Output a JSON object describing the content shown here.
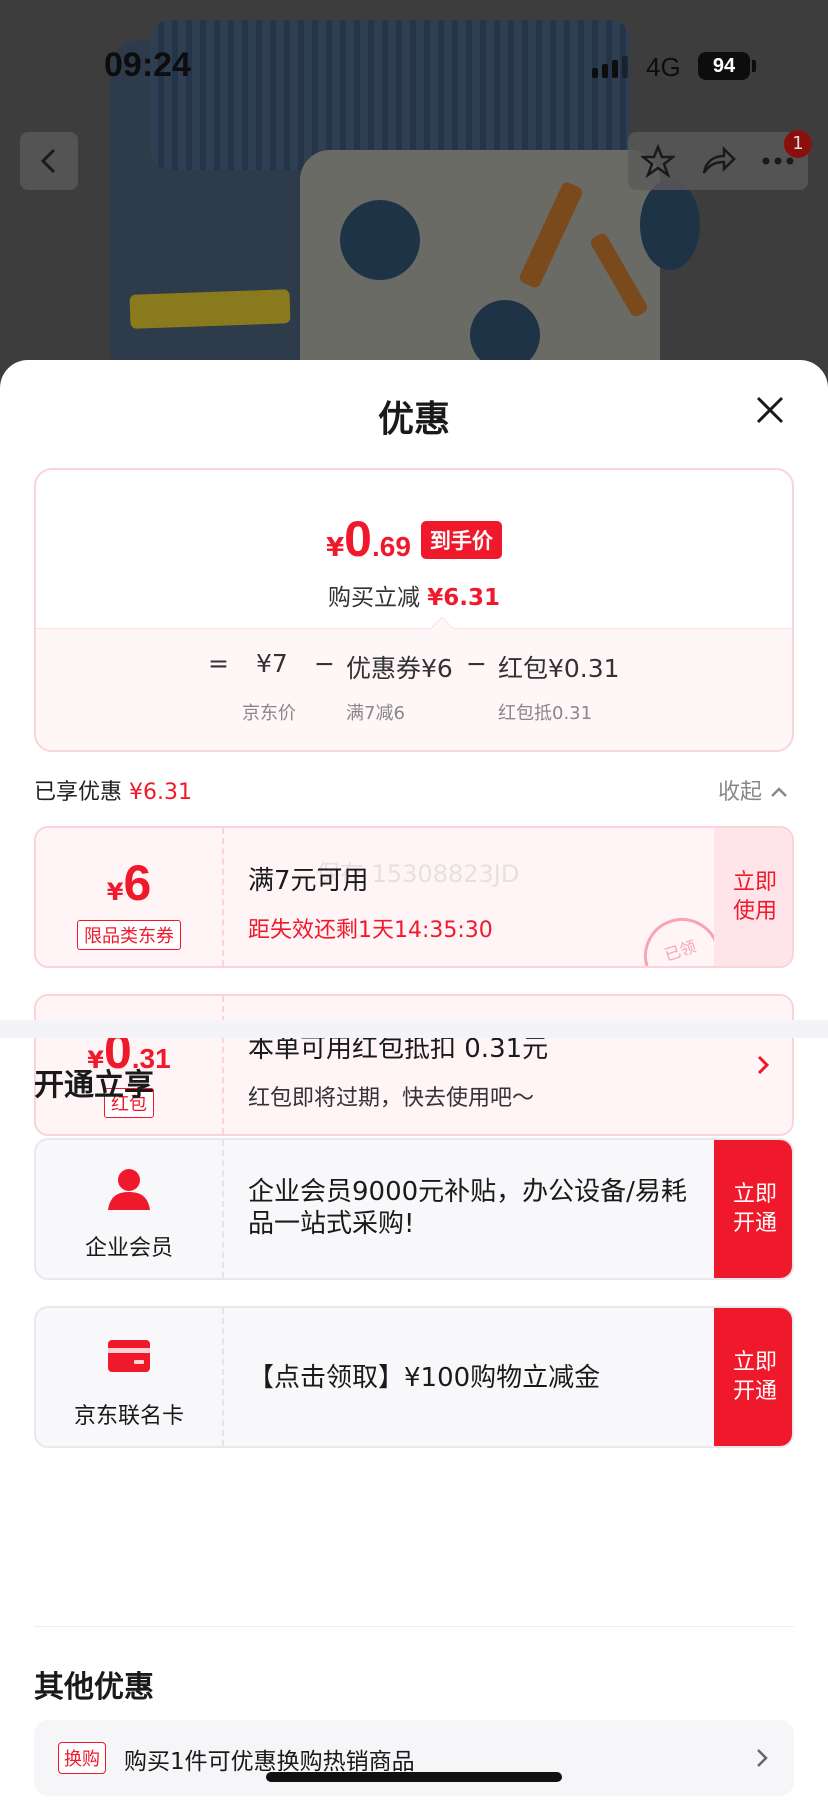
{
  "status_bar": {
    "time": "09:24",
    "network": "4G",
    "battery": "94"
  },
  "top_nav": {
    "cart_badge": "1",
    "icons": [
      "back-arrow-icon",
      "star-icon",
      "share-icon",
      "more-icon"
    ]
  },
  "sheet": {
    "title": "优惠",
    "close_icon": "close-icon"
  },
  "price_card": {
    "yen": "¥",
    "price_int": "0",
    "price_dec": ".69",
    "final_tag": "到手价",
    "reduce_label": "购买立减",
    "reduce_value": "¥6.31",
    "formula": {
      "equals": "=",
      "jd_price": "¥7",
      "jd_price_label": "京东价",
      "minus1": "−",
      "coupon": "优惠券¥6",
      "coupon_label": "满7减6",
      "minus2": "−",
      "redpacket": "红包¥0.31",
      "redpacket_label": "红包抵0.31"
    }
  },
  "enjoyed": {
    "label": "已享优惠",
    "value": "¥6.31",
    "collapse_label": "收起"
  },
  "coupons": [
    {
      "yen": "¥",
      "amount": "6",
      "decimal": "",
      "tag": "限品类东券",
      "main": "满7元可用",
      "sub": "距失效还剩1天14:35:30",
      "action": "立即\n使用",
      "stamp": "已领",
      "watermark": "保存  15308823JD"
    },
    {
      "yen": "¥",
      "amount": "0",
      "decimal": ".31",
      "tag": "红包",
      "main": "本单可用红包抵扣 0.31元",
      "sub": "红包即将过期，快去使用吧～"
    }
  ],
  "open_section": {
    "title": "开通立享",
    "items": [
      {
        "icon": "person-icon",
        "label": "企业会员",
        "text": "企业会员9000元补贴，办公设备/易耗品一站式采购!",
        "action": "立即\n开通",
        "icon_color": "#f0192b"
      },
      {
        "icon": "credit-card-icon",
        "label": "京东联名卡",
        "text": "【点击领取】¥100购物立减金",
        "action": "立即\n开通",
        "icon_color": "#f0192b"
      }
    ]
  },
  "other_section": {
    "title": "其他优惠",
    "tag": "换购",
    "text": "购买1件可优惠换购热销商品"
  },
  "colors": {
    "accent_red": "#f0192b",
    "pink_border": "#fbd3da",
    "pink_bg": "#fff5f6"
  }
}
